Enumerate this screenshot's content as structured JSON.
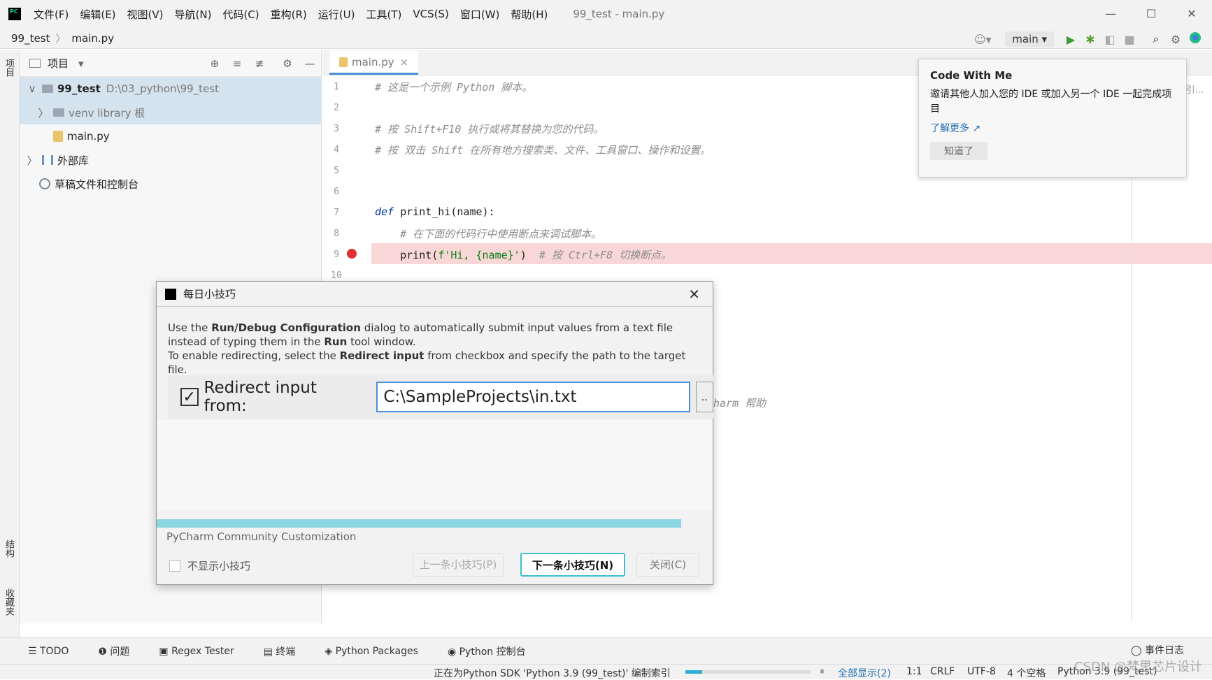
{
  "menubar": {
    "items": [
      "文件(F)",
      "编辑(E)",
      "视图(V)",
      "导航(N)",
      "代码(C)",
      "重构(R)",
      "运行(U)",
      "工具(T)",
      "VCS(S)",
      "窗口(W)",
      "帮助(H)"
    ],
    "window_title": "99_test - main.py"
  },
  "window_controls": {
    "minimize": "—",
    "maximize": "☐",
    "close": "✕"
  },
  "navbar": {
    "project": "99_test",
    "sep": "〉",
    "file": "main.py"
  },
  "toolbar": {
    "run_config": "main ▾",
    "user_icon": "☺▾",
    "run_icon": "▶",
    "debug_icon": "✱",
    "coverage_icon": "◧",
    "stop_icon": "■",
    "search_icon": "⌕",
    "settings_icon": "⚙"
  },
  "left_strip": {
    "project_tab": "项目",
    "structure_tab": "结构",
    "favorites_tab": "收藏夹"
  },
  "project_panel": {
    "title": "项目",
    "dropdown": "▾",
    "icons": {
      "locate": "⊕",
      "expand": "≡",
      "collapse": "≢",
      "settings": "⚙",
      "hide": "—"
    },
    "tree": [
      {
        "arrow": "∨",
        "name": "99_test",
        "path": "D:\\03_python\\99_test"
      },
      {
        "arrow": "〉",
        "name": "venv library 根"
      },
      {
        "arrow": "",
        "name": "main.py"
      },
      {
        "arrow": "〉",
        "name": "外部库"
      },
      {
        "arrow": "",
        "name": "草稿文件和控制台"
      }
    ]
  },
  "editor": {
    "tab": "main.py",
    "tab_close": "×",
    "line_numbers": [
      "1",
      "2",
      "3",
      "4",
      "5",
      "6",
      "7",
      "8",
      "9",
      "10"
    ],
    "lines": [
      {
        "n": 1,
        "parts": [
          {
            "c": "cm",
            "t": "# 这是一个示例 Python 脚本。"
          }
        ]
      },
      {
        "n": 3,
        "parts": [
          {
            "c": "cm",
            "t": "# 按 Shift+F10 执行或将其替换为您的代码。"
          }
        ]
      },
      {
        "n": 4,
        "parts": [
          {
            "c": "cm",
            "t": "# 按 双击 Shift 在所有地方搜索类、文件、工具窗口、操作和设置。"
          }
        ]
      },
      {
        "n": 7,
        "parts": [
          {
            "c": "kw",
            "t": "def"
          },
          {
            "c": "",
            "t": " print_hi(name):"
          }
        ]
      },
      {
        "n": 8,
        "parts": [
          {
            "c": "cm",
            "t": "    # 在下面的代码行中使用断点来调试脚本。"
          }
        ]
      },
      {
        "n": 9,
        "parts": [
          {
            "c": "",
            "t": "    print("
          },
          {
            "c": "str",
            "t": "f'Hi, {name}'"
          },
          {
            "c": "",
            "t": ")  "
          },
          {
            "c": "cm",
            "t": "# 按 Ctrl+F8 切换断点。"
          }
        ]
      }
    ],
    "hidden_fragment": "harm 帮助"
  },
  "popup": {
    "title": "Code With Me",
    "desc": "邀请其他人加入您的 IDE 或加入另一个 IDE 一起完成项目",
    "link": "了解更多 ↗",
    "button": "知道了",
    "edge_text": "引..."
  },
  "dialog": {
    "title": "每日小技巧",
    "close": "✕",
    "p1a": "Use the ",
    "p1b": "Run/Debug Configuration",
    "p1c": " dialog to automatically submit input values from a text file instead of typing them in the ",
    "p1d": "Run",
    "p1e": " tool window.",
    "p2a": "To enable redirecting, select the ",
    "p2b": "Redirect input",
    "p2c": " from checkbox and specify the path to the target file.",
    "demo_label": "Redirect input from:",
    "demo_check": "✓",
    "demo_value": "C:\\SampleProjects\\in.txt",
    "demo_browse": "..",
    "footer": "PyCharm Community Customization",
    "dont_show": "不显示小技巧",
    "prev": "上一条小技巧(P)",
    "next": "下一条小技巧(N)",
    "close_btn": "关闭(C)"
  },
  "bottom_tabs": [
    "☰ TODO",
    "❶ 问题",
    "▣ Regex Tester",
    "▤ 终端",
    "◈ Python Packages",
    "◉ Python 控制台"
  ],
  "event_log": "◯ 事件日志",
  "statusbar": {
    "indexing": "正在为Python SDK 'Python 3.9 (99_test)' 编制索引",
    "pause": "⏸",
    "show_all": "全部显示(2)",
    "position": "1:1",
    "line_sep": "CRLF",
    "encoding": "UTF-8",
    "indent": "4 个空格",
    "interpreter": "Python 3.9 (99_test)"
  },
  "watermark": "CSDN @梵思芯片设计"
}
